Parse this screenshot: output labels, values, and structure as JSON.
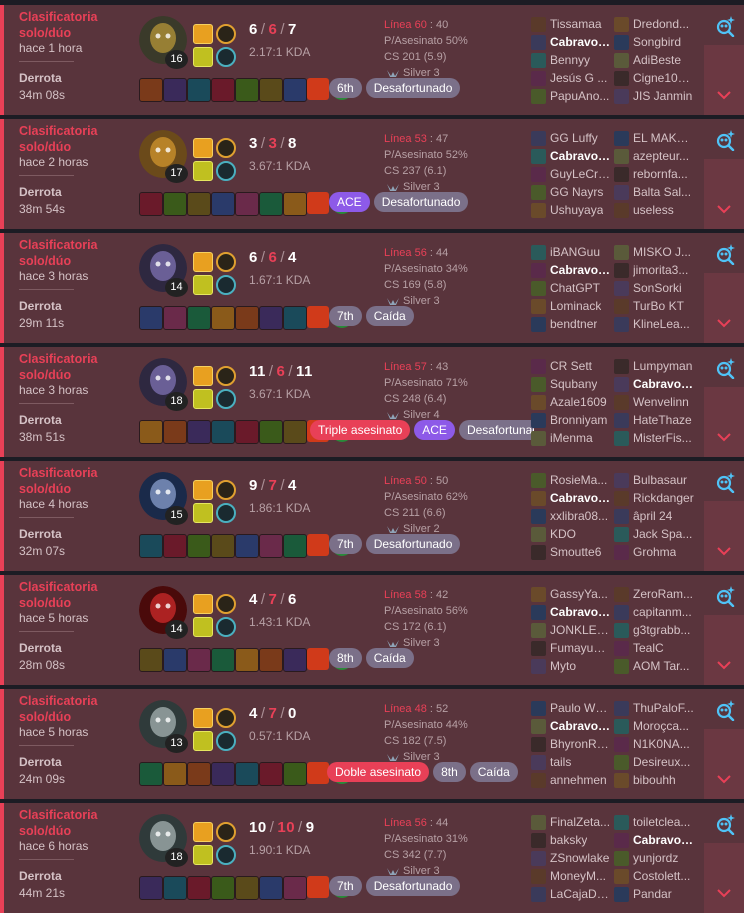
{
  "colors": {
    "loss_accent": "#e84057",
    "card_bg": "#59343c",
    "ace": "#8d5ae8",
    "tag_gray": "#7b7089",
    "sidebar_bg": "#6b3842"
  },
  "icons": {
    "expand": "chevron-down-icon",
    "ai_analysis": "magnifier-sparkle-icon",
    "tier": "silver-emblem-icon"
  },
  "matches": [
    {
      "queue": "Clasificatoria solo/dúo",
      "time_ago": "hace 1 hora",
      "result": "Derrota",
      "duration": "34m 08s",
      "level": "16",
      "kills": "6",
      "deaths": "6",
      "assists": "7",
      "kda_ratio": "2.17:1 KDA",
      "lp_label": "Línea 60",
      "lp_value": "40",
      "kill_participation": "P/Asesinato 50%",
      "cs": "CS 201 (5.9)",
      "tier": "Silver 3",
      "tags": [
        {
          "text": "6th",
          "style": "gray"
        },
        {
          "text": "Desafortunado",
          "style": "gray"
        }
      ],
      "blue_team": [
        "Tissamaa",
        "Cabravol...",
        "Bennyy",
        "Jesús G ...",
        "PapuAno..."
      ],
      "red_team": [
        "Dredond...",
        "Songbird",
        "AdiBeste",
        "Cigne100...",
        "JIS Janmin"
      ],
      "me_team": "blue",
      "me_index": 1
    },
    {
      "queue": "Clasificatoria solo/dúo",
      "time_ago": "hace 2 horas",
      "result": "Derrota",
      "duration": "38m 54s",
      "level": "17",
      "kills": "3",
      "deaths": "3",
      "assists": "8",
      "kda_ratio": "3.67:1 KDA",
      "lp_label": "Línea 53",
      "lp_value": "47",
      "kill_participation": "P/Asesinato 52%",
      "cs": "CS 237 (6.1)",
      "tier": "Silver 3",
      "tags": [
        {
          "text": "ACE",
          "style": "purple"
        },
        {
          "text": "Desafortunado",
          "style": "gray"
        }
      ],
      "blue_team": [
        "GG Luffy",
        "Cabravol...",
        "GuyLeCre...",
        "GG Nayrs",
        "Ushuyaya"
      ],
      "red_team": [
        "EL MAKE...",
        "azepteur...",
        "rebornfa...",
        "Balta Sal...",
        "useless"
      ],
      "me_team": "blue",
      "me_index": 1
    },
    {
      "queue": "Clasificatoria solo/dúo",
      "time_ago": "hace 3 horas",
      "result": "Derrota",
      "duration": "29m 11s",
      "level": "14",
      "kills": "6",
      "deaths": "6",
      "assists": "4",
      "kda_ratio": "1.67:1 KDA",
      "lp_label": "Línea 56",
      "lp_value": "44",
      "kill_participation": "P/Asesinato 34%",
      "cs": "CS 169 (5.8)",
      "tier": "Silver 3",
      "tags": [
        {
          "text": "7th",
          "style": "gray"
        },
        {
          "text": "Caída",
          "style": "gray"
        }
      ],
      "blue_team": [
        "iBANGuu",
        "Cabravol...",
        "ChatGPT",
        "Lominack",
        "bendtner"
      ],
      "red_team": [
        "MISKO J...",
        "jimorita3...",
        "SonSorki",
        "TurBo KT",
        "KlineLea..."
      ],
      "me_team": "blue",
      "me_index": 1
    },
    {
      "queue": "Clasificatoria solo/dúo",
      "time_ago": "hace 3 horas",
      "result": "Derrota",
      "duration": "38m 51s",
      "level": "18",
      "kills": "11",
      "deaths": "6",
      "assists": "11",
      "kda_ratio": "3.67:1 KDA",
      "lp_label": "Línea 57",
      "lp_value": "43",
      "kill_participation": "P/Asesinato 71%",
      "cs": "CS 248 (6.4)",
      "tier": "Silver 4",
      "tags": [
        {
          "text": "Triple asesinato",
          "style": "red"
        },
        {
          "text": "ACE",
          "style": "purple"
        },
        {
          "text": "Desafortunado",
          "style": "gray"
        }
      ],
      "blue_team": [
        "CR Sett",
        "Squbany",
        "Azale1609",
        "Bronniyam",
        "iMenma"
      ],
      "red_team": [
        "Lumpyman",
        "Cabravol...",
        "Wenvelinn",
        "HateThaze",
        "MisterFis..."
      ],
      "me_team": "red",
      "me_index": 1
    },
    {
      "queue": "Clasificatoria solo/dúo",
      "time_ago": "hace 4 horas",
      "result": "Derrota",
      "duration": "32m 07s",
      "level": "15",
      "kills": "9",
      "deaths": "7",
      "assists": "4",
      "kda_ratio": "1.86:1 KDA",
      "lp_label": "Línea 50",
      "lp_value": "50",
      "kill_participation": "P/Asesinato 62%",
      "cs": "CS 211 (6.6)",
      "tier": "Silver 2",
      "tags": [
        {
          "text": "7th",
          "style": "gray"
        },
        {
          "text": "Desafortunado",
          "style": "gray"
        }
      ],
      "blue_team": [
        "RosieMa...",
        "Cabravol...",
        "xxlibra08...",
        "KDO",
        "Smoutte6"
      ],
      "red_team": [
        "Bulbasaur",
        "Rickdanger",
        "âpril 24",
        "Jack Spa...",
        "Grohma"
      ],
      "me_team": "blue",
      "me_index": 1
    },
    {
      "queue": "Clasificatoria solo/dúo",
      "time_ago": "hace 5 horas",
      "result": "Derrota",
      "duration": "28m 08s",
      "level": "14",
      "kills": "4",
      "deaths": "7",
      "assists": "6",
      "kda_ratio": "1.43:1 KDA",
      "lp_label": "Línea 58",
      "lp_value": "42",
      "kill_participation": "P/Asesinato 56%",
      "cs": "CS 172 (6.1)",
      "tier": "Silver 3",
      "tags": [
        {
          "text": "8th",
          "style": "gray"
        },
        {
          "text": "Caída",
          "style": "gray"
        }
      ],
      "blue_team": [
        "GassyYa...",
        "Cabravol...",
        "JONKLER...",
        "Fumayusi...",
        "Myto"
      ],
      "red_team": [
        "ZeroRam...",
        "capitanm...",
        "g3tgrabb...",
        "TealC",
        "AOM Tar..."
      ],
      "me_team": "blue",
      "me_index": 1
    },
    {
      "queue": "Clasificatoria solo/dúo",
      "time_ago": "hace 5 horas",
      "result": "Derrota",
      "duration": "24m 09s",
      "level": "13",
      "kills": "4",
      "deaths": "7",
      "assists": "0",
      "kda_ratio": "0.57:1 KDA",
      "lp_label": "Línea 48",
      "lp_value": "52",
      "kill_participation": "P/Asesinato 44%",
      "cs": "CS 182 (7.5)",
      "tier": "Silver 3",
      "tags": [
        {
          "text": "Doble asesinato",
          "style": "red"
        },
        {
          "text": "8th",
          "style": "gray"
        },
        {
          "text": "Caída",
          "style": "gray"
        }
      ],
      "blue_team": [
        "Paulo Wh...",
        "Cabravol...",
        "BhyronRo...",
        "tails",
        "annehmen"
      ],
      "red_team": [
        "ThuPaloF...",
        "Moroçca...",
        "N1K0NA...",
        "Desireux...",
        "bibouhh"
      ],
      "me_team": "blue",
      "me_index": 1
    },
    {
      "queue": "Clasificatoria solo/dúo",
      "time_ago": "hace 6 horas",
      "result": "Derrota",
      "duration": "44m 21s",
      "level": "18",
      "kills": "10",
      "deaths": "10",
      "assists": "9",
      "kda_ratio": "1.90:1 KDA",
      "lp_label": "Línea 56",
      "lp_value": "44",
      "kill_participation": "P/Asesinato 31%",
      "cs": "CS 342 (7.7)",
      "tier": "Silver 3",
      "tags": [
        {
          "text": "7th",
          "style": "gray"
        },
        {
          "text": "Desafortunado",
          "style": "gray"
        }
      ],
      "blue_team": [
        "FinalZeta...",
        "baksky",
        "ZSnowlake",
        "MoneyM...",
        "LaCajaDo..."
      ],
      "red_team": [
        "toiletclea...",
        "Cabravol...",
        "yunjordz",
        "Costolett...",
        "Pandar"
      ],
      "me_team": "red",
      "me_index": 1
    }
  ]
}
